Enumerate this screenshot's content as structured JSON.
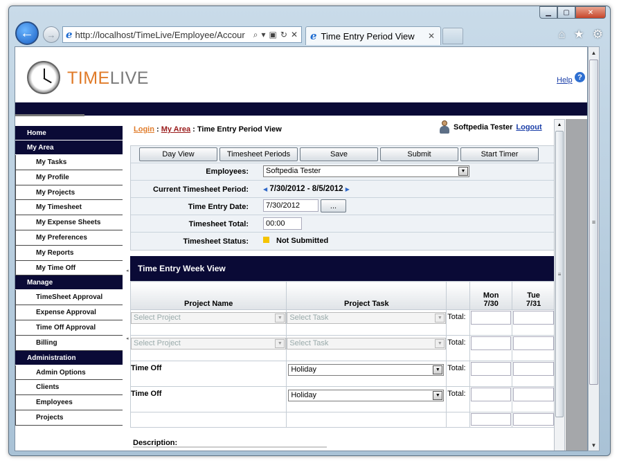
{
  "browser": {
    "address": "http://localhost/TimeLive/Employee/Accour",
    "tab_title": "Time Entry Period View",
    "back_glyph": "←",
    "forward_glyph": "→",
    "tab_close_glyph": "✕"
  },
  "header": {
    "logo_part1": "TIME",
    "logo_part2": "LIVE",
    "help_label": "Help"
  },
  "sidebar": {
    "sections": [
      {
        "title": "Home",
        "items": []
      },
      {
        "title": "My Area",
        "items": [
          "My Tasks",
          "My Profile",
          "My Projects",
          "My Timesheet",
          "My Expense Sheets",
          "My Preferences",
          "My Reports",
          "My Time Off"
        ]
      },
      {
        "title": "Manage",
        "items": [
          "TimeSheet Approval",
          "Expense Approval",
          "Time Off Approval",
          "Billing"
        ]
      },
      {
        "title": "Administration",
        "items": [
          "Admin Options",
          "Clients",
          "Employees",
          "Projects"
        ]
      }
    ]
  },
  "breadcrumb": {
    "login": "Login",
    "sep1": " : ",
    "my_area": "My Area",
    "sep2": " : ",
    "current": "Time Entry Period View"
  },
  "user": {
    "name": "Softpedia Tester",
    "logout": "Logout"
  },
  "toolbar": {
    "day_view": "Day View",
    "timesheet_periods": "Timesheet Periods",
    "save": "Save",
    "submit": "Submit",
    "start_timer": "Start Timer"
  },
  "form": {
    "employees_label": "Employees:",
    "employees_value": "Softpedia Tester",
    "period_label": "Current Timesheet Period:",
    "period_value": "7/30/2012 - 8/5/2012",
    "date_label": "Time Entry Date:",
    "date_value": "7/30/2012",
    "date_btn": "...",
    "total_label": "Timesheet Total:",
    "total_value": "00:00",
    "status_label": "Timesheet Status:",
    "status_value": "Not Submitted",
    "status_color": "#f5c400"
  },
  "week": {
    "title": "Time Entry Week View",
    "col_project": "Project Name",
    "col_task": "Project Task",
    "days": [
      {
        "name": "Mon",
        "date": "7/30"
      },
      {
        "name": "Tue",
        "date": "7/31"
      }
    ],
    "total_label": "Total:",
    "select_project": "Select Project",
    "select_task": "Select Task",
    "timeoff_label": "Time Off",
    "holiday": "Holiday",
    "description_label": "Description:"
  },
  "colors": {
    "brand_orange": "#e07b29",
    "nav_dark": "#0a0a36",
    "link_blue": "#1a3ea8"
  }
}
